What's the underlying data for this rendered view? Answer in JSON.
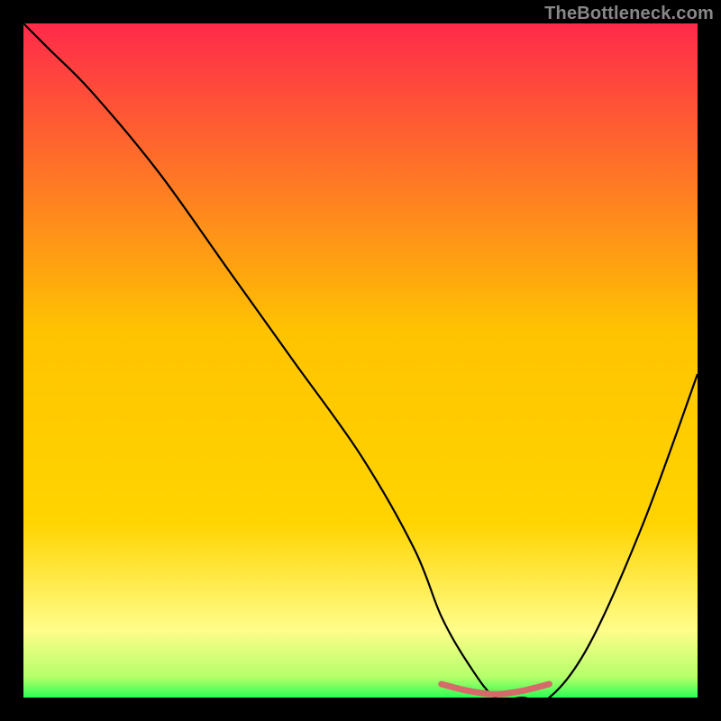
{
  "attribution": "TheBottleneck.com",
  "colors": {
    "bg": "#000000",
    "grad_top": "#ff2a4a",
    "grad_mid": "#ffd400",
    "grad_low": "#fffd8a",
    "grad_bottom": "#2dff54",
    "curve": "#000000",
    "accent": "#d66a6a"
  },
  "chart_data": {
    "type": "line",
    "title": "",
    "xlabel": "",
    "ylabel": "",
    "xlim": [
      0,
      100
    ],
    "ylim": [
      0,
      100
    ],
    "series": [
      {
        "name": "main-curve",
        "x": [
          0,
          4,
          10,
          20,
          30,
          40,
          50,
          58,
          62,
          66,
          70,
          74,
          78,
          84,
          92,
          100
        ],
        "y": [
          100,
          96,
          90,
          78,
          64,
          50,
          36,
          22,
          12,
          5,
          0,
          0,
          0,
          8,
          26,
          48
        ]
      }
    ],
    "accent_segment": {
      "name": "trough-highlight",
      "x": [
        62,
        66,
        70,
        74,
        78
      ],
      "y": [
        2,
        1,
        0.5,
        1,
        2
      ]
    }
  }
}
